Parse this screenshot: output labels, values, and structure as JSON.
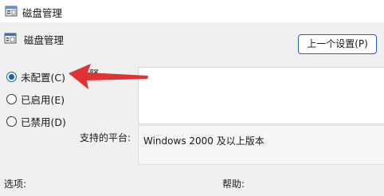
{
  "window": {
    "title": "磁盘管理",
    "icon": "policy-window-icon"
  },
  "header": {
    "policy_name": "磁盘管理",
    "icon": "policy-setting-icon"
  },
  "toolbar": {
    "prev_setting_label": "上一个设置(P)"
  },
  "state_options": [
    {
      "label": "未配置(C)",
      "checked": true
    },
    {
      "label": "已启用(E)",
      "checked": false
    },
    {
      "label": "已禁用(D)",
      "checked": false
    }
  ],
  "comment": {
    "label_partial": "释",
    "value": ""
  },
  "supported_platforms": {
    "label": "支持的平台:",
    "value": "Windows 2000 及以上版本"
  },
  "sections": {
    "options_label": "选项:",
    "help_label": "帮助:"
  },
  "annotation": {
    "arrow_color": "#e03434",
    "points_to": "未配置(C)"
  },
  "colors": {
    "accent": "#1a5fb4",
    "background": "#f0f0f0"
  }
}
